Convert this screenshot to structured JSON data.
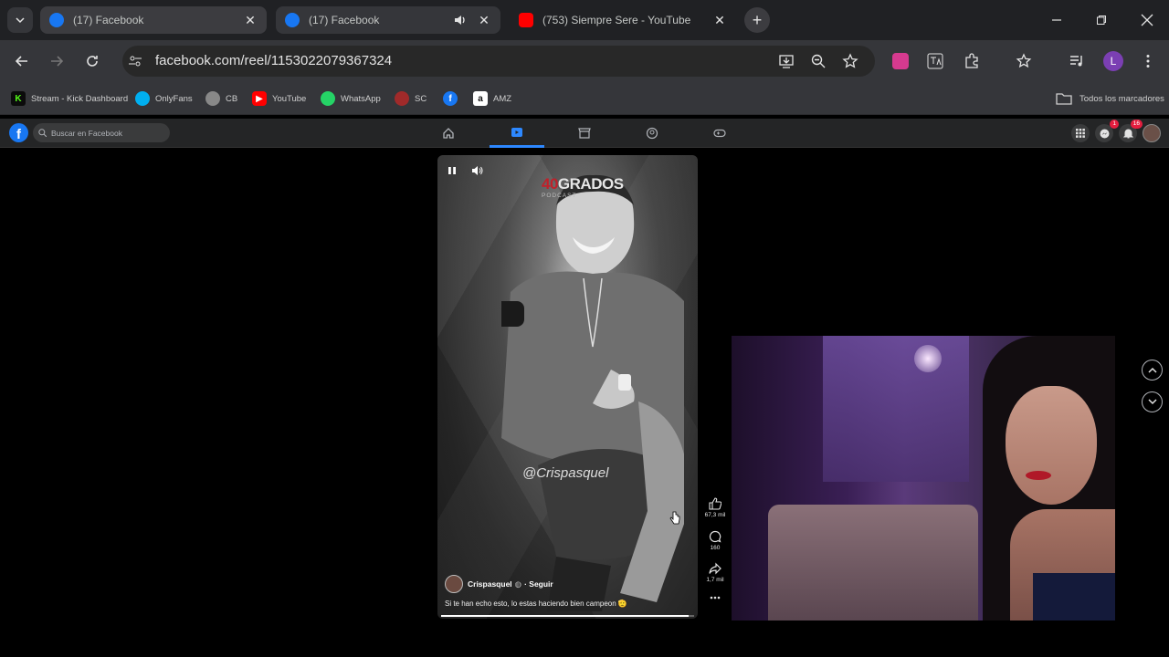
{
  "browser": {
    "tabs": [
      {
        "title": "(17) Facebook",
        "favicon": "facebook-icon"
      },
      {
        "title": "(17) Facebook",
        "favicon": "facebook-icon",
        "audio": true
      },
      {
        "title": "(753) Siempre Sere - YouTube",
        "favicon": "youtube-icon"
      }
    ],
    "url": "facebook.com/reel/1153022079367324",
    "profile_initial": "L",
    "bookmarks": [
      {
        "label": "Stream - Kick Dashboard",
        "icon": "kick-icon",
        "color": "#53fc18"
      },
      {
        "label": "OnlyFans",
        "icon": "onlyfans-icon",
        "color": "#00aff0"
      },
      {
        "label": "CB",
        "icon": "cb-icon",
        "color": "#f47321"
      },
      {
        "label": "YouTube",
        "icon": "youtube-icon",
        "color": "#ff0000"
      },
      {
        "label": "WhatsApp",
        "icon": "whatsapp-icon",
        "color": "#25d366"
      },
      {
        "label": "SC",
        "icon": "sc-icon",
        "color": "#d93b3b"
      },
      {
        "label": "",
        "icon": "facebook-icon",
        "color": "#1877f2"
      },
      {
        "label": "AMZ",
        "icon": "amazon-icon",
        "color": "#ff9900"
      }
    ],
    "all_bookmarks": "Todos los marcadores"
  },
  "facebook": {
    "search_placeholder": "Buscar en Facebook",
    "messenger_badge": "1",
    "notifications_badge": "16",
    "accent": "#1877f2"
  },
  "reel": {
    "podcast_logo_a": "40",
    "podcast_logo_b": "GRADOS",
    "podcast_sub": "PODCAST",
    "watermark": "@Crispasquel",
    "author": "Crispasquel",
    "follow": "· Seguir",
    "caption": "Si te han echo esto, lo estas haciendo bien campeon 🫡",
    "progress": 0.98,
    "likes": "67,3 mil",
    "comments": "160",
    "shares": "1,7 mil"
  }
}
